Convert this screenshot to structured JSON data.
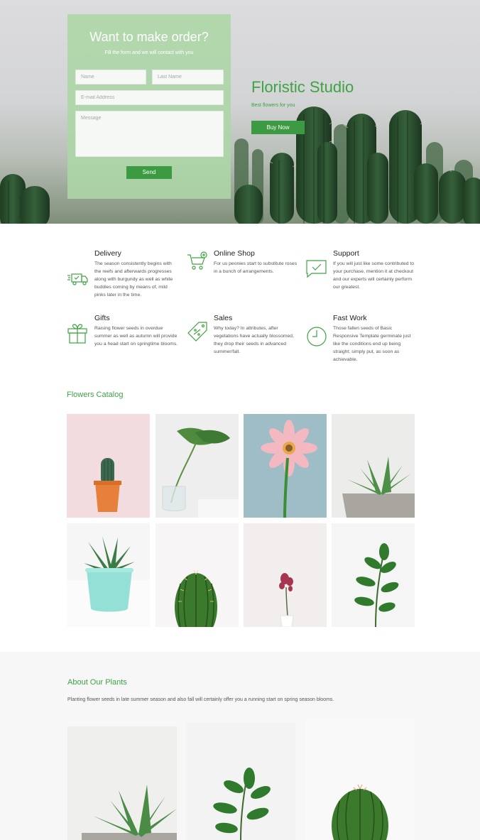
{
  "order_form": {
    "title": "Want to make order?",
    "subtitle": "Fill the form and we will contact with you",
    "name_placeholder": "Name",
    "last_name_placeholder": "Last Name",
    "email_placeholder": "E-mail Address",
    "message_placeholder": "Message",
    "send_label": "Send"
  },
  "hero": {
    "title": "Floristic Studio",
    "tagline": "Best flowers for you",
    "buy_label": "Buy Now"
  },
  "features": [
    {
      "title": "Delivery",
      "icon": "delivery-truck-icon",
      "text": "The season consistently begins with the reefs and afterwards progresses along with burgundy as well as white buddies coming by means of, mild pinks later in the time."
    },
    {
      "title": "Online Shop",
      "icon": "shopping-cart-icon",
      "text": "For us peonies start to substitute roses in a bunch of arrangements."
    },
    {
      "title": "Support",
      "icon": "chat-check-icon",
      "text": "If you will just like some contributed to your purchase, mention it at checkout and our experts will certainly perform our greatest."
    },
    {
      "title": "Gifts",
      "icon": "gift-box-icon",
      "text": "Raising flower seeds in overdue summer as well as autumn will provide you a head start on springtime blooms."
    },
    {
      "title": "Sales",
      "icon": "discount-tag-icon",
      "text": "Why today? In attributes, after vegetations have actually blossomed, they drop their seeds in advanced summer/fall."
    },
    {
      "title": "Fast Work",
      "icon": "clock-icon",
      "text": "Those fallen seeds of Basic Responsive Template germinate just like the conditions end up being straight; simply put, as soon as achievable."
    }
  ],
  "catalog": {
    "title": "Flowers Catalog",
    "items": [
      "cactus-orange-pot",
      "monstera-leaf-vase",
      "pink-gerbera",
      "succulent-grey-pot",
      "aloe-mint-pot",
      "round-cactus",
      "dried-flower-bud",
      "ficus-plant"
    ]
  },
  "about": {
    "title": "About Our Plants",
    "text": "Planting flower seeds in late summer season and also fall will certainly offer you a running start on spring season blooms."
  },
  "colors": {
    "accent": "#3fa344",
    "button": "#3b9a42",
    "card": "#acd6a6"
  }
}
